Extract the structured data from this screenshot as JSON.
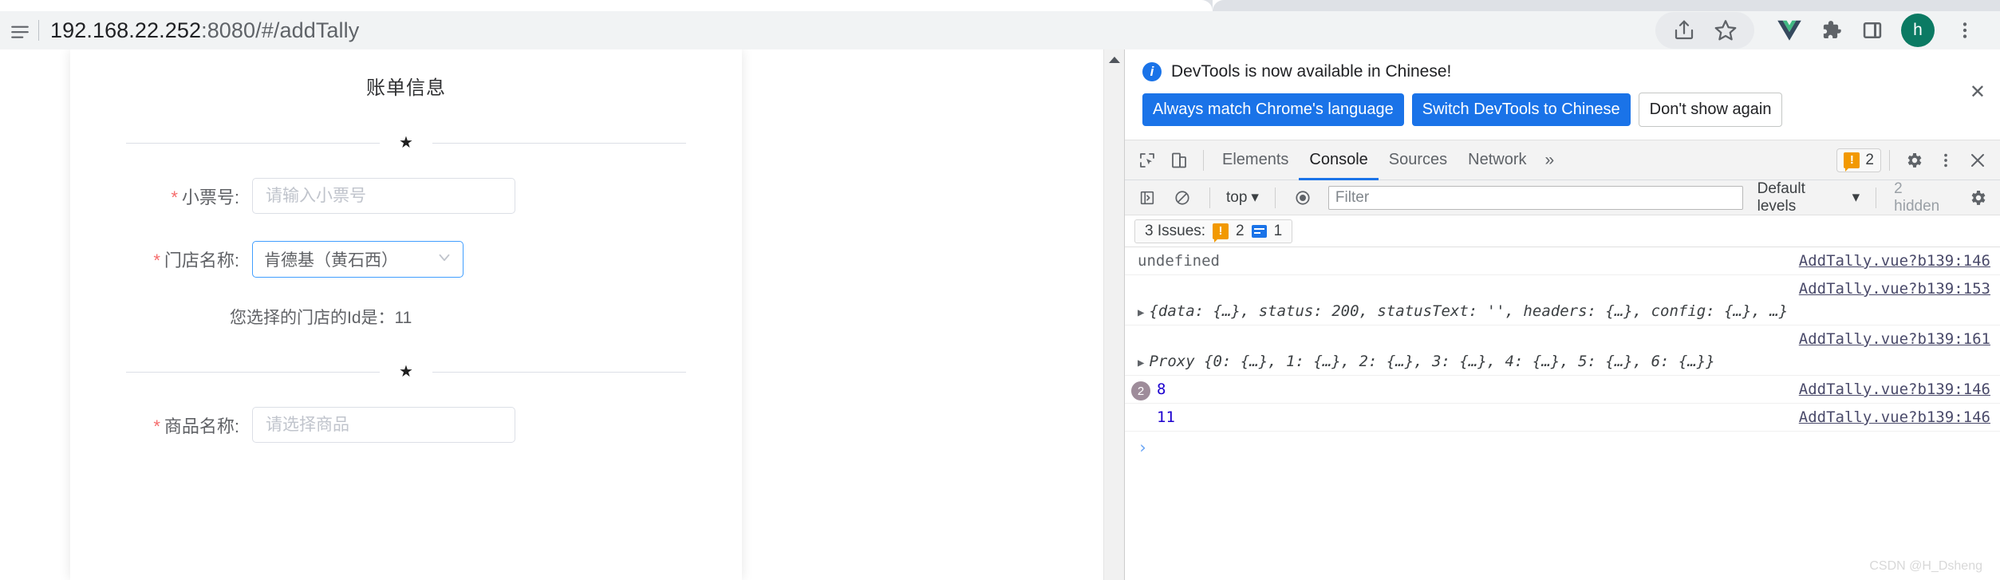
{
  "browser": {
    "url_main": "192.168.22.252",
    "url_rest": ":8080/#/addTally",
    "icons": {
      "page_info": "page-info-icon",
      "share": "share-icon",
      "bookmark": "star-icon",
      "vue_devtools": "vue-devtools-icon",
      "extensions": "puzzle-icon",
      "side_panel": "side-panel-icon",
      "menu": "kebab-menu-icon"
    },
    "avatar_letter": "h"
  },
  "page": {
    "title": "账单信息",
    "divider_star": "★",
    "fields": [
      {
        "label": "小票号:",
        "required": true,
        "type": "input",
        "value": "",
        "placeholder": "请输入小票号"
      },
      {
        "label": "门店名称:",
        "required": true,
        "type": "select",
        "value": "肯德基（黄石西）",
        "placeholder": ""
      },
      {
        "label": "商品名称:",
        "required": true,
        "type": "input",
        "value": "",
        "placeholder": "请选择商品"
      }
    ],
    "store_id_hint": "您选择的门店的Id是：11"
  },
  "devtools": {
    "banner": {
      "message": "DevTools is now available in Chinese!",
      "btn_always": "Always match Chrome's language",
      "btn_switch": "Switch DevTools to Chinese",
      "btn_dismiss": "Don't show again",
      "close": "✕"
    },
    "tabs": [
      {
        "label": "Elements",
        "active": false
      },
      {
        "label": "Console",
        "active": true
      },
      {
        "label": "Sources",
        "active": false
      },
      {
        "label": "Network",
        "active": false
      }
    ],
    "more_tabs": "»",
    "warning_count": "2",
    "console_toolbar": {
      "context": "top",
      "filter_placeholder": "Filter",
      "filter_value": "",
      "levels": "Default levels",
      "hidden": "2 hidden"
    },
    "issues": {
      "label": "3 Issues:",
      "warning_count": "2",
      "info_count": "1"
    },
    "logs": [
      {
        "kind": "value",
        "text": "undefined",
        "source": "AddTally.vue?b139:146",
        "muted": true,
        "badge": ""
      },
      {
        "kind": "object",
        "text": "{data: {…}, status: 200, statusText: '', headers: {…}, config: {…}, …}",
        "source": "AddTally.vue?b139:153",
        "muted": false,
        "badge": ""
      },
      {
        "kind": "object",
        "text": "Proxy {0: {…}, 1: {…}, 2: {…}, 3: {…}, 4: {…}, 5: {…}, 6: {…}}",
        "source": "AddTally.vue?b139:161",
        "muted": false,
        "badge": ""
      },
      {
        "kind": "number",
        "text": "8",
        "source": "AddTally.vue?b139:146",
        "muted": false,
        "badge": "2"
      },
      {
        "kind": "number",
        "text": "11",
        "source": "AddTally.vue?b139:146",
        "muted": false,
        "badge": ""
      }
    ],
    "prompt": "›"
  },
  "watermark": "CSDN @H_Dsheng"
}
